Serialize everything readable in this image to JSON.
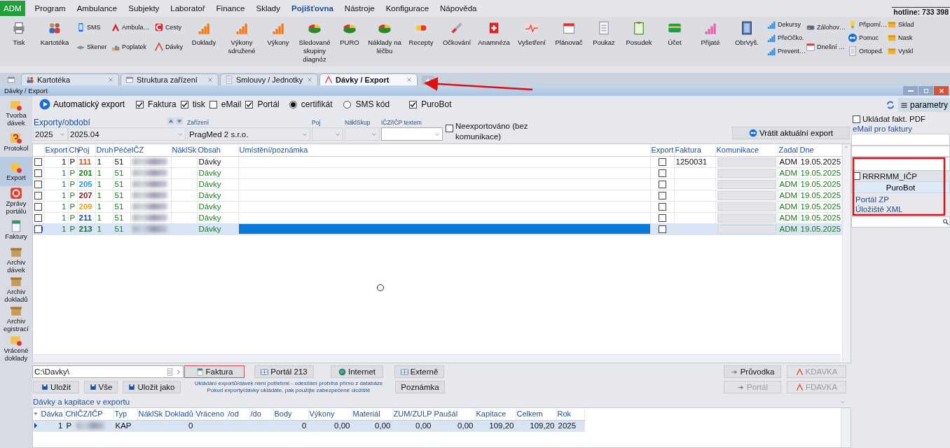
{
  "menu": {
    "badge": "ADM",
    "items": [
      {
        "label": "Program",
        "selected": false
      },
      {
        "label": "Ambulance",
        "selected": false
      },
      {
        "label": "Subjekty",
        "selected": false
      },
      {
        "label": "Laboratoř",
        "selected": false
      },
      {
        "label": "Finance",
        "selected": false
      },
      {
        "label": "Sklady",
        "selected": false
      },
      {
        "label": "Pojišťovna",
        "selected": true
      },
      {
        "label": "Nástroje",
        "selected": false
      },
      {
        "label": "Konfigurace",
        "selected": false
      },
      {
        "label": "Nápověda",
        "selected": false
      }
    ],
    "hotline": "hotline: 733 398"
  },
  "ribbon": [
    {
      "kind": "large",
      "label": "Tisk"
    },
    {
      "kind": "large",
      "label": "Kartotéka"
    },
    {
      "kind": "stack",
      "items": [
        "SMS",
        "Skener"
      ]
    },
    {
      "kind": "stack",
      "items": [
        "Ambula…",
        "Poplatek"
      ]
    },
    {
      "kind": "stack",
      "items": [
        "Cesty",
        "Dávky"
      ]
    },
    {
      "kind": "large",
      "label": "Doklady"
    },
    {
      "kind": "large",
      "label": "Výkony sdružené"
    },
    {
      "kind": "large",
      "label": "Výkony"
    },
    {
      "kind": "large",
      "label": "Sledované skupiny diagnóz"
    },
    {
      "kind": "large",
      "label": "PURO"
    },
    {
      "kind": "large",
      "label": "Náklady na léčbu"
    },
    {
      "kind": "large",
      "label": "Recepty"
    },
    {
      "kind": "large",
      "label": "Očkování"
    },
    {
      "kind": "large",
      "label": "Anamnéza"
    },
    {
      "kind": "large",
      "label": "Vyšetření"
    },
    {
      "kind": "large",
      "label": "Plánovač"
    },
    {
      "kind": "large",
      "label": "Poukaz"
    },
    {
      "kind": "large",
      "label": "Posudek"
    },
    {
      "kind": "large",
      "label": "Účet"
    },
    {
      "kind": "large",
      "label": "Přijaté"
    },
    {
      "kind": "large",
      "label": "ObrVyš."
    },
    {
      "kind": "stack",
      "items": [
        "Dekursy",
        "PřeOčko.",
        "Prevent…"
      ]
    },
    {
      "kind": "stack",
      "items": [
        "Zálohov…",
        "Dnešní …"
      ]
    },
    {
      "kind": "stack",
      "items": [
        "Připomí…",
        "Pomoc",
        "Ortoped."
      ]
    },
    {
      "kind": "stack",
      "items": [
        "Sklad",
        "Nask",
        "Vyskl"
      ]
    }
  ],
  "tabs": [
    {
      "label": "Kartotéka",
      "selected": false
    },
    {
      "label": "Struktura zařízení",
      "selected": false
    },
    {
      "label": "Smlouvy / Jednotky",
      "selected": false
    },
    {
      "label": "Dávky / Export",
      "selected": true
    }
  ],
  "window": {
    "title": "Dávky / Export"
  },
  "sidebar": {
    "items": [
      {
        "label": "Tvorba dávek",
        "selected": false
      },
      {
        "label": "Protokol",
        "selected": false
      },
      {
        "label": "Export",
        "selected": true
      },
      {
        "label": "Zprávy portálu",
        "selected": false
      },
      {
        "label": "Faktury",
        "selected": false
      },
      {
        "label": "Archiv dávek",
        "selected": false
      },
      {
        "label": "Archiv dokladů",
        "selected": false
      },
      {
        "label": "Archiv egistrací",
        "selected": false
      },
      {
        "label": "Vrácené doklady",
        "selected": false
      }
    ]
  },
  "toolbar": {
    "auto_export": "Automatický export",
    "options": [
      {
        "kind": "checkbox",
        "label": "Faktura",
        "checked": true
      },
      {
        "kind": "checkbox",
        "label": "tisk",
        "checked": true
      },
      {
        "kind": "checkbox",
        "label": "eMail",
        "checked": false
      },
      {
        "kind": "checkbox",
        "label": "Portál",
        "checked": true
      },
      {
        "kind": "radio",
        "label": "certifikát",
        "selected": true
      },
      {
        "kind": "radio",
        "label": "SMS kód",
        "selected": false
      },
      {
        "kind": "checkbox",
        "label": "PuroBot",
        "checked": true
      }
    ],
    "parameters": "parametry"
  },
  "filters": {
    "title": "Exporty/období",
    "fields": [
      {
        "kind": "select",
        "value": "2025"
      },
      {
        "kind": "select",
        "value": "2025.04"
      },
      {
        "kind": "select",
        "label": "Zařízení",
        "value": "PragMed 2 s.r.o."
      },
      {
        "kind": "select",
        "label": "Poj"
      },
      {
        "kind": "select",
        "label": "NáklSkup"
      },
      {
        "kind": "input",
        "label": "IČZ/IČP textem"
      }
    ],
    "not_exported": {
      "label": "Neexportováno (bez komunikace)",
      "checked": false
    },
    "revert_button": "Vrátit aktuální export"
  },
  "table": {
    "columns": [
      "Export",
      "Ch",
      "Poj",
      "Druh",
      "Péče",
      "IČZ",
      "NáklSk",
      "Obsah",
      "Umístění/poznámka",
      "Export",
      "Faktura",
      "Komunikace",
      "Zadal",
      "Dne"
    ],
    "rows": [
      {
        "checked": false,
        "export": "1",
        "ch": "P",
        "poj": "111",
        "color": "#d2541e",
        "druh": "1",
        "pece": "51",
        "obsah": "Dávky",
        "export_checked": false,
        "faktura": "1250031",
        "zadal": "ADM",
        "dne": "19.05.2025",
        "sent": false,
        "selected": false
      },
      {
        "checked": false,
        "export": "1",
        "ch": "P",
        "poj": "201",
        "color": "#1a7a1a",
        "druh": "1",
        "pece": "51",
        "obsah": "Dávky",
        "export_checked": false,
        "zadal": "ADM",
        "dne": "19.05.2025",
        "sent": true,
        "selected": false
      },
      {
        "checked": false,
        "export": "1",
        "ch": "P",
        "poj": "205",
        "color": "#2a9ad8",
        "druh": "1",
        "pece": "51",
        "obsah": "Dávky",
        "export_checked": false,
        "zadal": "ADM",
        "dne": "19.05.2025",
        "sent": true,
        "selected": false
      },
      {
        "checked": false,
        "export": "1",
        "ch": "P",
        "poj": "207",
        "color": "#8b1a2a",
        "druh": "1",
        "pece": "51",
        "obsah": "Dávky",
        "export_checked": false,
        "zadal": "ADM",
        "dne": "19.05.2025",
        "sent": true,
        "selected": false
      },
      {
        "checked": false,
        "export": "1",
        "ch": "P",
        "poj": "209",
        "color": "#f0a020",
        "druh": "1",
        "pece": "51",
        "obsah": "Dávky",
        "export_checked": false,
        "zadal": "ADM",
        "dne": "19.05.2025",
        "sent": true,
        "selected": false
      },
      {
        "checked": false,
        "export": "1",
        "ch": "P",
        "poj": "211",
        "color": "#1f4e8c",
        "druh": "1",
        "pece": "51",
        "obsah": "Dávky",
        "export_checked": false,
        "zadal": "ADM",
        "dne": "19.05.2025",
        "sent": true,
        "selected": false
      },
      {
        "checked": false,
        "export": "1",
        "ch": "P",
        "poj": "213",
        "color": "#1a6a3a",
        "druh": "1",
        "pece": "51",
        "obsah": "Dávky",
        "export_checked": false,
        "zadal": "ADM",
        "dne": "19.05.2025",
        "sent": true,
        "selected": true
      }
    ]
  },
  "side_panel": {
    "save_pdf": {
      "label": "Ukládat fakt. PDF",
      "checked": false
    },
    "email_label": "eMail pro faktury",
    "icp": {
      "label": "RRRRMM_IČP",
      "checked": false
    },
    "purobot": "PuroBot",
    "links": [
      "Portál ZP",
      "Úložiště XML"
    ]
  },
  "export_bar": {
    "path": "C:\\Davky\\",
    "buttons": [
      {
        "label": "Faktura",
        "focused": true,
        "disabled": false
      },
      {
        "label": "Portál 213",
        "focused": false,
        "disabled": false
      },
      {
        "label": "Internet",
        "focused": false,
        "disabled": false
      },
      {
        "label": "Externě",
        "focused": false,
        "disabled": false
      },
      {
        "label": "Průvodka",
        "focused": false,
        "disabled": false
      },
      {
        "label": "KDAVKA",
        "focused": false,
        "disabled": true
      }
    ],
    "save_buttons": [
      "Uložit",
      "Vše",
      "Uložit jako"
    ],
    "info": [
      "Ukládání exportů/dávek není potřebné - odesílání probíhá přímo z databáze",
      "Pokud exporty/dávky ukládáte, pak použijte zabezpečené úložiště"
    ],
    "note_button": "Poznámka",
    "right_buttons": [
      {
        "label": "Portál",
        "disabled": true
      },
      {
        "label": "FDAVKA",
        "disabled": true
      }
    ]
  },
  "batches": {
    "title": "Dávky a kapitace v exportu",
    "columns": [
      "Dávka",
      "Ch",
      "IČZ/IČP",
      "Typ",
      "NáklSk",
      "Dokladů",
      "Vráceno",
      "/od",
      "/do",
      "Body",
      "Výkony",
      "Materiál",
      "ZUM/ZULP",
      "Paušál",
      "Kapitace",
      "Celkem",
      "Rok"
    ],
    "rows": [
      {
        "davka": "1",
        "ch": "P",
        "typ": "KAP",
        "dokladu": "0",
        "body": "0",
        "vykony": "0,00",
        "material": "0,00",
        "zum": "0,00",
        "pausal": "0,00",
        "kapitace": "109,20",
        "celkem": "109,20",
        "rok": "2025",
        "selected": true
      }
    ]
  }
}
